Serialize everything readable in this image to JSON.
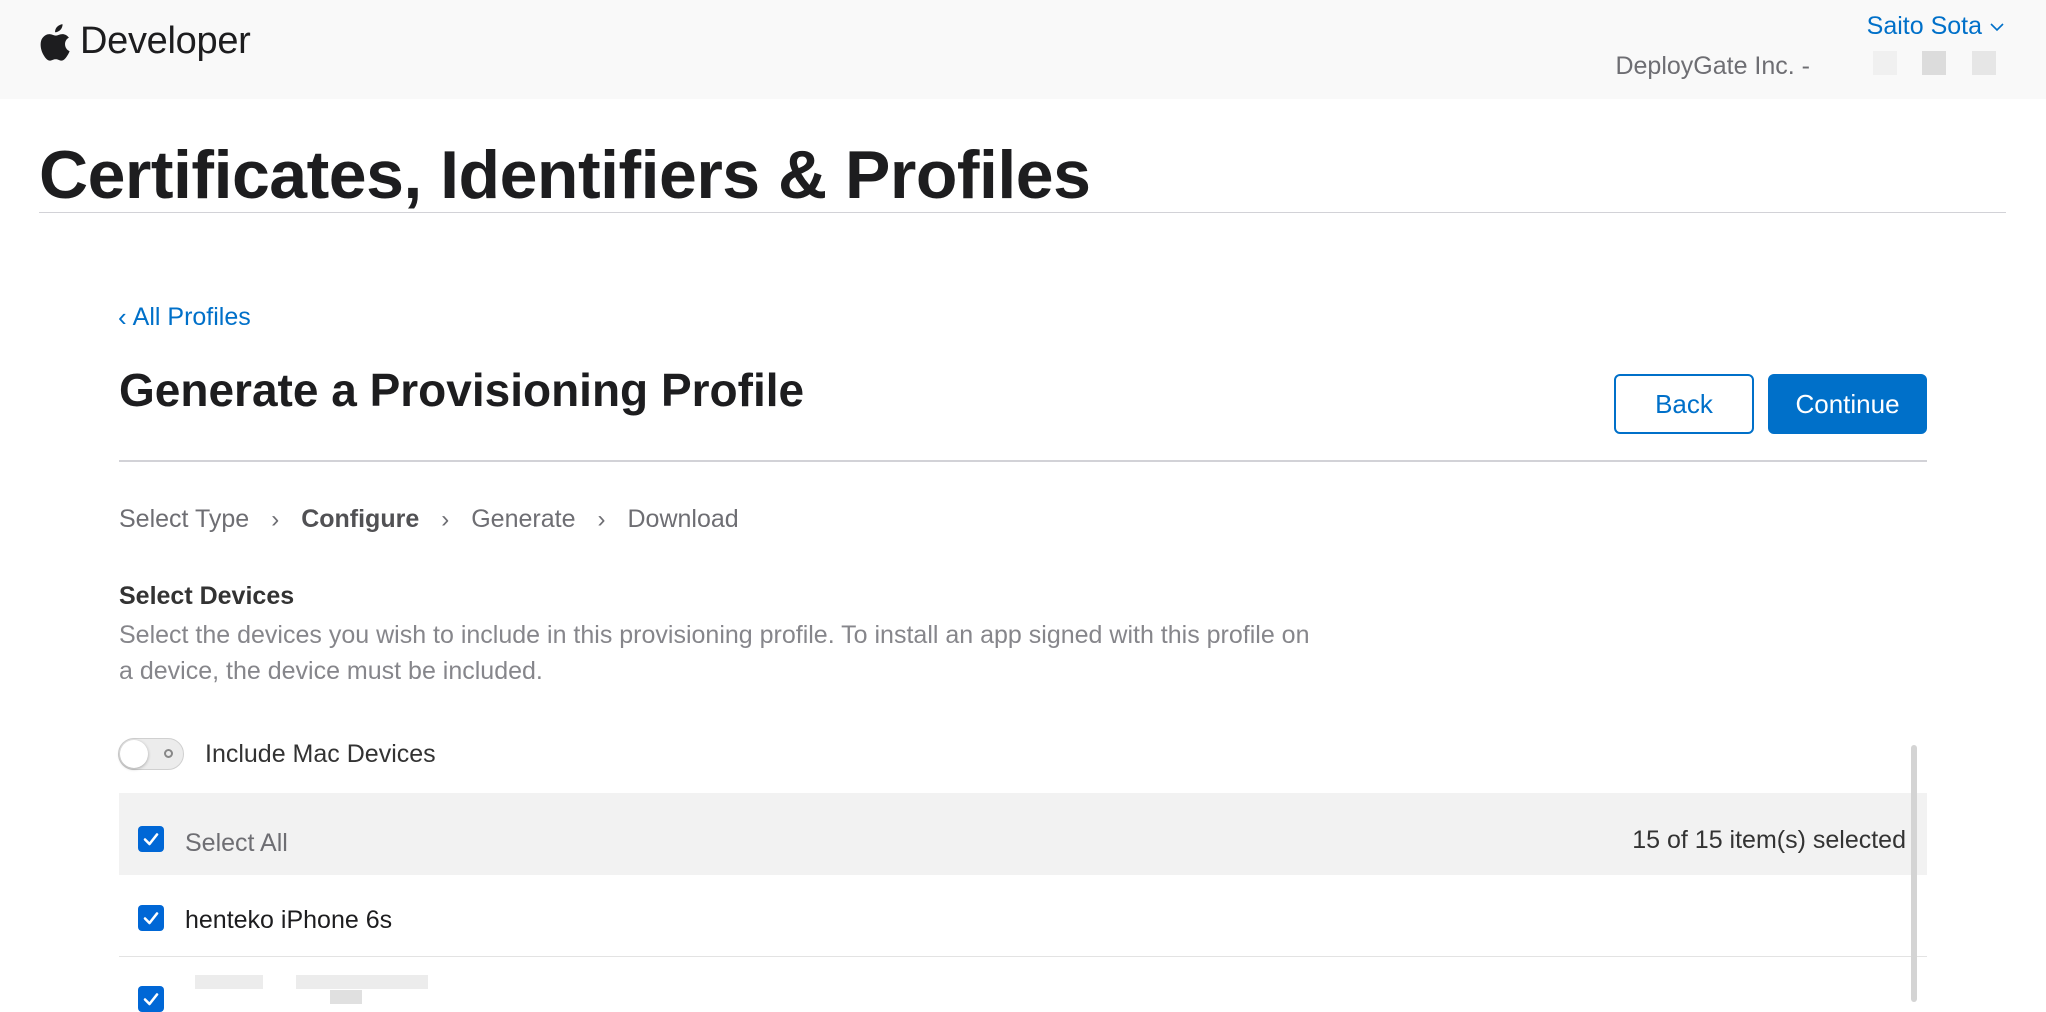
{
  "header": {
    "brand_label": "Developer",
    "user_name": "Saito Sota",
    "team_name": "DeployGate Inc. -"
  },
  "page": {
    "title": "Certificates, Identifiers & Profiles",
    "back_link": "All Profiles",
    "heading": "Generate a Provisioning Profile",
    "back_button": "Back",
    "continue_button": "Continue"
  },
  "steps": [
    {
      "label": "Select Type",
      "active": false
    },
    {
      "label": "Configure",
      "active": true
    },
    {
      "label": "Generate",
      "active": false
    },
    {
      "label": "Download",
      "active": false
    }
  ],
  "devices": {
    "heading": "Select Devices",
    "description": "Select the devices you wish to include in this provisioning profile. To install an app signed with this profile on a device, the device must be included.",
    "include_mac_label": "Include Mac Devices",
    "include_mac_enabled": false,
    "select_all_label": "Select All",
    "select_all_checked": true,
    "selected_count": "15 of 15 item(s) selected",
    "rows": [
      {
        "label": "henteko iPhone 6s",
        "checked": true
      },
      {
        "label": "",
        "checked": true
      }
    ]
  },
  "colors": {
    "accent": "#0070c9",
    "checkbox": "#0067d6",
    "header_bg": "#f9f9f9"
  },
  "icons": [
    "apple-logo-icon",
    "chevron-down-icon",
    "chevron-left-icon",
    "chevron-right-icon",
    "checkmark-icon"
  ]
}
